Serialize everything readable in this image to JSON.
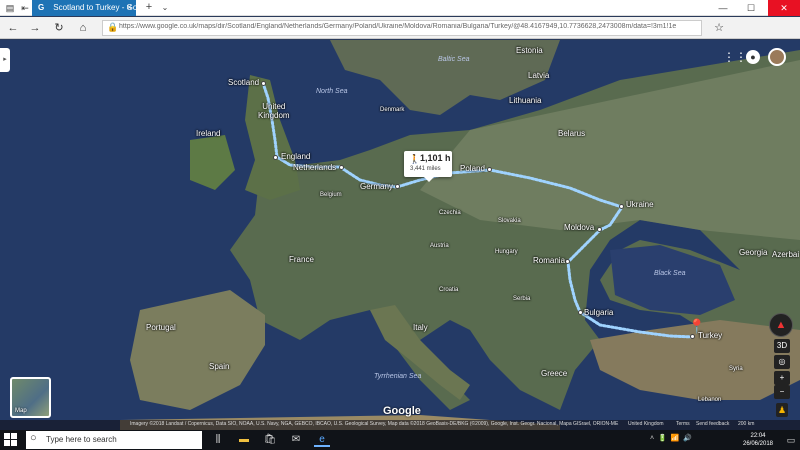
{
  "browser": {
    "tab_title": "Scotland to Turkey - Go",
    "tab_favicon": "G",
    "url": "https://www.google.co.uk/maps/dir/Scotland/England/Netherlands/Germany/Poland/Ukraine/Moldova/Romania/Bulgaria/Turkey/@48.4167949,10.7736628,2473008m/data=!3m1!1e",
    "icons": [
      "back-icon",
      "forward-icon",
      "refresh-icon",
      "home-icon",
      "lock-icon",
      "favorite-star-icon",
      "minimize-icon",
      "maximize-icon",
      "close-icon"
    ]
  },
  "map": {
    "countries": [
      {
        "id": "estonia",
        "text": "Estonia"
      },
      {
        "id": "latvia",
        "text": "Latvia"
      },
      {
        "id": "lithuania",
        "text": "Lithuania"
      },
      {
        "id": "belarus",
        "text": "Belarus"
      },
      {
        "id": "ireland",
        "text": "Ireland"
      },
      {
        "id": "denmark",
        "text": "Denmark"
      },
      {
        "id": "belgium",
        "text": "Belgium"
      },
      {
        "id": "czechia",
        "text": "Czechia"
      },
      {
        "id": "slovakia",
        "text": "Slovakia"
      },
      {
        "id": "austria",
        "text": "Austria"
      },
      {
        "id": "hungary",
        "text": "Hungary"
      },
      {
        "id": "france",
        "text": "France"
      },
      {
        "id": "croatia",
        "text": "Croatia"
      },
      {
        "id": "serbia",
        "text": "Serbia"
      },
      {
        "id": "italy",
        "text": "Italy"
      },
      {
        "id": "portugal",
        "text": "Portugal"
      },
      {
        "id": "spain",
        "text": "Spain"
      },
      {
        "id": "greece",
        "text": "Greece"
      },
      {
        "id": "georgia",
        "text": "Georgia"
      },
      {
        "id": "azerbaijan",
        "text": "Azerbai"
      },
      {
        "id": "syria",
        "text": "Syria"
      },
      {
        "id": "lebanon",
        "text": "Lebanon"
      }
    ],
    "seas": [
      {
        "id": "north-sea",
        "text": "North Sea"
      },
      {
        "id": "baltic-sea",
        "text": "Baltic Sea"
      },
      {
        "id": "black-sea",
        "text": "Black Sea"
      },
      {
        "id": "tyrrhenian-sea",
        "text": "Tyrrhenian Sea"
      }
    ],
    "stops": [
      {
        "id": "scotland",
        "text": "Scotland"
      },
      {
        "id": "united-kingdom",
        "text": "United\nKingdom"
      },
      {
        "id": "england",
        "text": "England"
      },
      {
        "id": "netherlands",
        "text": "Netherlands"
      },
      {
        "id": "germany",
        "text": "Germany"
      },
      {
        "id": "poland",
        "text": "Poland"
      },
      {
        "id": "ukraine",
        "text": "Ukraine"
      },
      {
        "id": "moldova",
        "text": "Moldova"
      },
      {
        "id": "romania",
        "text": "Romania"
      },
      {
        "id": "bulgaria",
        "text": "Bulgaria"
      },
      {
        "id": "turkey",
        "text": "Turkey"
      }
    ],
    "route_summary": {
      "duration": "1,101 h",
      "distance": "3,441 miles"
    },
    "layer_label": "Map",
    "google_logo": "Google",
    "controls": {
      "tilt": "3D",
      "zoom_in": "+",
      "zoom_out": "−"
    },
    "footer": {
      "imagery": "Imagery ©2018 Landsat / Copernicus, Data SIO, NOAA, U.S. Navy, NGA, GEBCO, IBCAO, U.S. Geological Survey, Map data ©2018 GeoBasis-DE/BKG (©2009), Google, Inst. Geogr. Nacional, Mapa GISrael, ORION-ME",
      "region": "United Kingdom",
      "terms": "Terms",
      "feedback": "Send feedback",
      "scale": "200 km"
    },
    "route_color": "#9fd3ff"
  },
  "taskbar": {
    "search_placeholder": "Type here to search",
    "time": "22:04",
    "date": "26/06/2018"
  }
}
